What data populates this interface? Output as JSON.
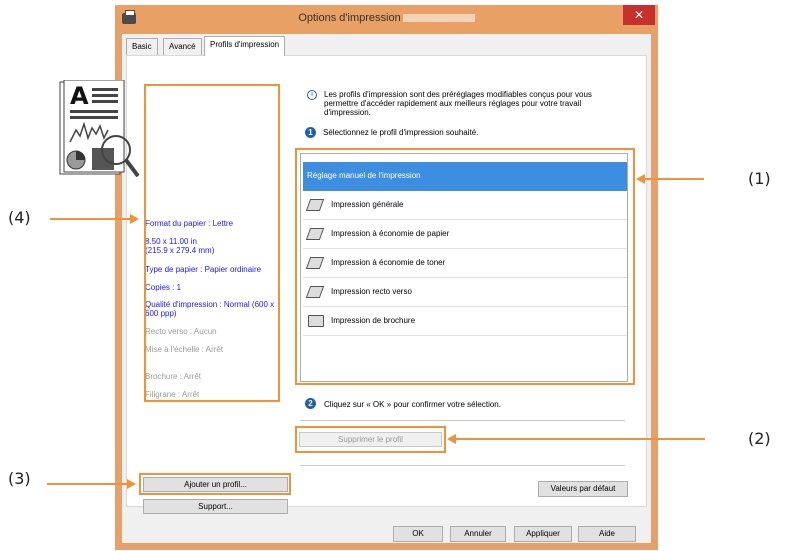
{
  "window": {
    "title": "Options d'impression",
    "close_glyph": "✕"
  },
  "tabs": [
    {
      "label": "Basic"
    },
    {
      "label": "Avancé"
    },
    {
      "label": "Profils d'impression",
      "active": true
    }
  ],
  "summary": {
    "paper_size": "Format du papier : Lettre",
    "paper_dims": "8.50 x 11.00 in",
    "paper_dims_mm": "(215.9 x 279.4 mm)",
    "media_type": "Type de papier : Papier ordinaire",
    "copies": "Copies : 1",
    "quality": "Qualité d'impression : Normal (600 x",
    "quality2": "600 ppp)",
    "duplex": "Recto verso : Aucun",
    "scaling": "Mise à l'échelle : Arrêt",
    "booklet": "Brochure : Arrêt",
    "watermark": "Filigrane : Arrêt"
  },
  "info": {
    "icon": "info-icon",
    "text": "Les profils d'impression sont des préréglages modifiables conçus pour vous permettre d'accéder rapidement aux meilleurs réglages pour votre travail d'impression."
  },
  "step1": {
    "number": "1",
    "text": "Sélectionnez le profil d'impression souhaité."
  },
  "step2": {
    "number": "2",
    "text": "Cliquez sur « OK » pour confirmer votre sélection."
  },
  "profiles": [
    {
      "label": "Réglage manuel de l'impression",
      "icon": "",
      "selected": true
    },
    {
      "label": "Impression générale",
      "icon": "general-print-icon"
    },
    {
      "label": "Impression à économie de papier",
      "icon": "paper-save-icon"
    },
    {
      "label": "Impression à économie de toner",
      "icon": "toner-save-icon"
    },
    {
      "label": "Impression recto verso",
      "icon": "duplex-icon"
    },
    {
      "label": "Impression de brochure",
      "icon": "booklet-icon"
    }
  ],
  "buttons": {
    "delete_profile": "Supprimer le profil",
    "add_profile": "Ajouter un profil...",
    "support": "Support...",
    "defaults": "Valeurs par défaut",
    "ok": "OK",
    "cancel": "Annuler",
    "apply": "Appliquer",
    "help": "Aide"
  },
  "callouts": {
    "c1": "(1)",
    "c2": "(2)",
    "c3": "(3)",
    "c4": "(4)"
  },
  "colors": {
    "accent_orange": "#f0923a",
    "title_bar": "#e9a064",
    "selection_blue": "#3d8ee0",
    "summary_blue": "#1a1aff"
  }
}
